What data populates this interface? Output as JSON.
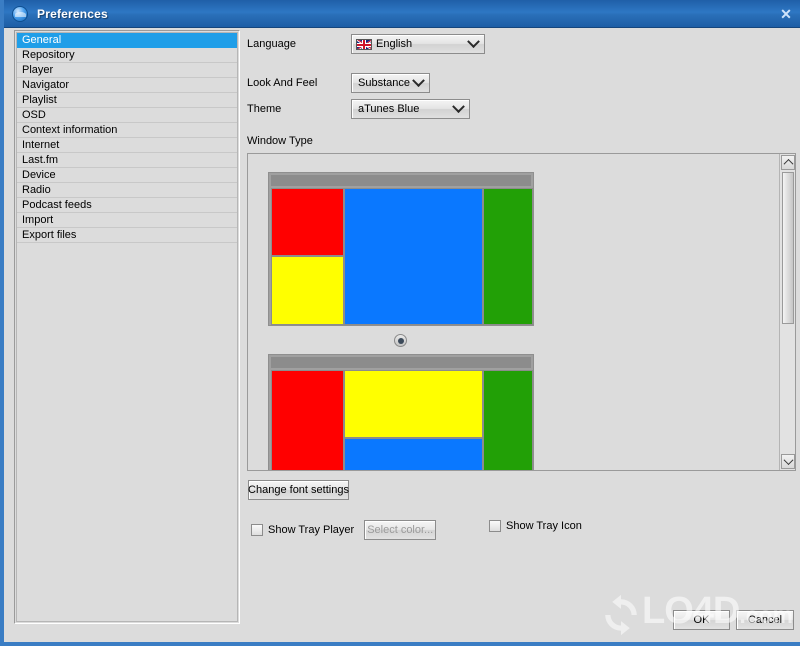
{
  "window": {
    "title": "Preferences",
    "icon": "app-circle-icon",
    "close_label": "✕",
    "accent": "#2e77c4",
    "frame_color": "#3a7dc4",
    "background": "#dcdcdc"
  },
  "sidebar": {
    "selected_index": 0,
    "selection_color": "#1f9ee8",
    "items": [
      {
        "label": "General"
      },
      {
        "label": "Repository"
      },
      {
        "label": "Player"
      },
      {
        "label": "Navigator"
      },
      {
        "label": "Playlist"
      },
      {
        "label": "OSD"
      },
      {
        "label": "Context information"
      },
      {
        "label": "Internet"
      },
      {
        "label": "Last.fm"
      },
      {
        "label": "Device"
      },
      {
        "label": "Radio"
      },
      {
        "label": "Podcast feeds"
      },
      {
        "label": "Import"
      },
      {
        "label": "Export files"
      }
    ]
  },
  "general": {
    "language": {
      "label": "Language",
      "value": "English",
      "flag": "uk-flag-icon"
    },
    "look_and_feel": {
      "label": "Look And Feel",
      "value": "Substance"
    },
    "theme": {
      "label": "Theme",
      "value": "aTunes Blue"
    },
    "window_type": {
      "label": "Window Type",
      "selected_index": 0,
      "options": [
        {
          "name": "layout-standard",
          "selected": true,
          "panels": [
            {
              "color": "#ff0000",
              "name": "red-panel"
            },
            {
              "color": "#ffff00",
              "name": "yellow-panel"
            },
            {
              "color": "#0a78ff",
              "name": "blue-panel"
            },
            {
              "color": "#22a006",
              "name": "green-panel"
            }
          ]
        },
        {
          "name": "layout-alternate",
          "selected": false,
          "panels": [
            {
              "color": "#ff0000",
              "name": "red-panel"
            },
            {
              "color": "#ffff00",
              "name": "yellow-panel"
            },
            {
              "color": "#0a78ff",
              "name": "blue-panel"
            },
            {
              "color": "#22a006",
              "name": "green-panel"
            }
          ]
        }
      ]
    },
    "font_button": "Change font settings",
    "show_tray_player": {
      "label": "Show Tray Player",
      "checked": false
    },
    "select_color_button": {
      "label": "Select color...",
      "disabled": true
    },
    "show_tray_icon": {
      "label": "Show Tray Icon",
      "checked": false
    }
  },
  "footer": {
    "ok_label": "OK",
    "cancel_label": "Cancel"
  },
  "watermark": {
    "text": "LO4D",
    "suffix": ".com"
  }
}
